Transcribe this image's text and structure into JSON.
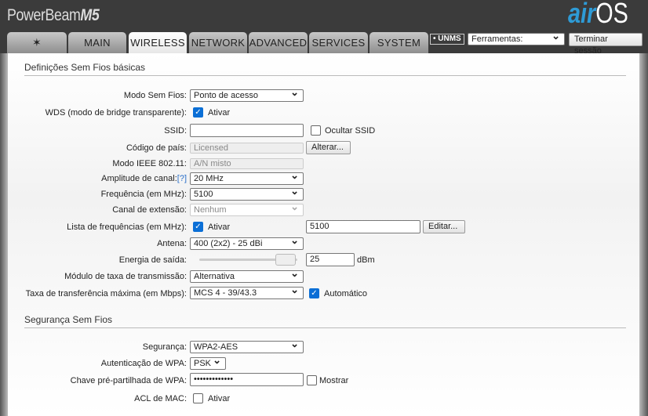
{
  "header": {
    "product": "PowerBeam",
    "model": "M5",
    "logo_air": "air",
    "logo_os": "OS"
  },
  "tabs": [
    {
      "label": ""
    },
    {
      "label": "MAIN"
    },
    {
      "label": "WIRELESS"
    },
    {
      "label": "NETWORK"
    },
    {
      "label": "ADVANCED"
    },
    {
      "label": "SERVICES"
    },
    {
      "label": "SYSTEM"
    }
  ],
  "toolbar": {
    "unms": "UNMS",
    "tools": "Ferramentas:",
    "logout": "Terminar sessão"
  },
  "basic": {
    "title": "Definições Sem Fios básicas",
    "mode_label": "Modo Sem Fios:",
    "mode": "Ponto de acesso",
    "wds_label": "WDS (modo de bridge transparente):",
    "wds_enable": "Ativar",
    "ssid_label": "SSID:",
    "ssid": "",
    "hide_ssid": "Ocultar SSID",
    "country_label": "Código de país:",
    "country": "Licensed",
    "change": "Alterar...",
    "ieee_label": "Modo IEEE 802.11:",
    "ieee": "A/N misto",
    "width_label": "Amplitude de canal:",
    "help": "[?]",
    "width": "20 MHz",
    "freq_label": "Frequência (em MHz):",
    "freq": "5100",
    "ext_label": "Canal de extensão:",
    "ext": "Nenhum",
    "freqlist_label": "Lista de frequências (em MHz):",
    "freqlist_enable": "Ativar",
    "freqlist": "5100",
    "edit": "Editar...",
    "antenna_label": "Antena:",
    "antenna": "400 (2x2) - 25 dBi",
    "power_label": "Energia de saída:",
    "power": "25",
    "power_unit": "dBm",
    "power_fraction": 0.95,
    "rate_module_label": "Módulo de taxa de transmissão:",
    "rate_module": "Alternativa",
    "max_rate_label": "Taxa de transferência máxima (em Mbps):",
    "max_rate": "MCS 4 - 39/43.3",
    "auto": "Automático"
  },
  "security": {
    "title": "Segurança Sem Fios",
    "sec_label": "Segurança:",
    "sec": "WPA2-AES",
    "auth_label": "Autenticação de WPA:",
    "auth": "PSK",
    "key_label": "Chave pré-partilhada de WPA:",
    "key": "•••••••••••••",
    "show": "Mostrar",
    "acl_label": "ACL de MAC:",
    "acl_enable": "Ativar"
  }
}
